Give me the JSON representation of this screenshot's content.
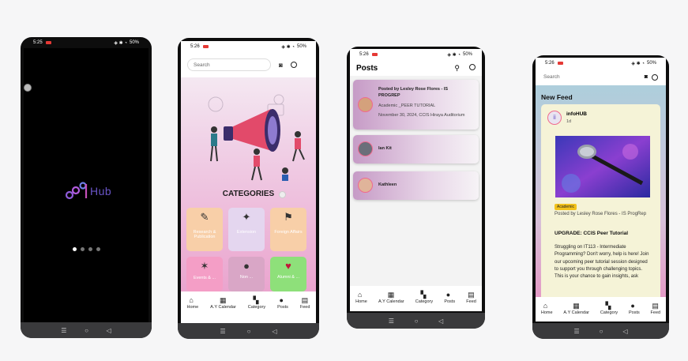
{
  "phone1": {
    "status_time": "5:25",
    "status_right": "50%",
    "logo_text": "Hub"
  },
  "phone2": {
    "status_time": "5:26",
    "status_right": "50%",
    "search_placeholder": "Search",
    "categories_title": "CATEGORIES",
    "tiles": [
      {
        "label": "Research & Publication",
        "color": "#f8cfa8"
      },
      {
        "label": "Extension",
        "color": "#e4d6ef"
      },
      {
        "label": "Foreign Affairs",
        "color": "#f8cfa8"
      },
      {
        "label": "Events & ...",
        "color": "#f49ec6"
      },
      {
        "label": "Non ...",
        "color": "#d9a6c6"
      },
      {
        "label": "Alumni & ...",
        "color": "#8ee07a"
      }
    ],
    "tabs": [
      "Home",
      "A.Y Calendar",
      "Category",
      "Posts",
      "Feed"
    ]
  },
  "phone3": {
    "status_time": "5:26",
    "status_right": "50%",
    "title": "Posts",
    "posts": [
      {
        "name": "Posted by Lesley Rose Flores - IS PROGREP",
        "line2": "Academic _PEER TUTORIAL",
        "line3": "November 30, 2024, CCIS Hiraya Auditorium"
      },
      {
        "name": "Ian Kit"
      },
      {
        "name": "Kathleen"
      }
    ],
    "tabs": [
      "Home",
      "A.Y Calendar",
      "Category",
      "Posts",
      "Feed"
    ]
  },
  "phone4": {
    "status_time": "5:26",
    "status_right": "50%",
    "search_placeholder": "Search",
    "feed_title": "New Feed",
    "author": "infoHUB",
    "time_ago": "1d",
    "badge": "Academic",
    "posted_by": "Posted by Lesley Rose Flores - IS ProgRep",
    "headline": "UPGRADE: CCIS Peer Tutorial",
    "body": "Struggling on IT113 - Intermediate Programming? Don't worry, help is here! Join our upcoming peer tutorial session designed to support you through challenging topics. This is your chance to gain insights, ask",
    "tabs": [
      "Home",
      "A.Y Calendar",
      "Category",
      "Posts",
      "Feed"
    ]
  }
}
